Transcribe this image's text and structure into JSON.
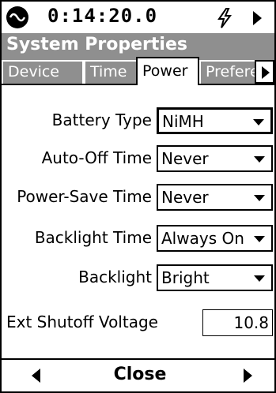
{
  "status": {
    "time": "0:14:20.0",
    "logo_icon": "meter-logo-icon",
    "power_icon": "lightning-bolt-icon",
    "run_icon": "play-triangle-icon"
  },
  "window": {
    "title": "System Properties"
  },
  "tabs": [
    {
      "label": "Device",
      "active": false
    },
    {
      "label": "Time",
      "active": false
    },
    {
      "label": "Power",
      "active": true
    },
    {
      "label": "Preferences",
      "active": false
    }
  ],
  "form": {
    "battery_type": {
      "label": "Battery Type",
      "value": "NiMH"
    },
    "auto_off_time": {
      "label": "Auto-Off Time",
      "value": "Never"
    },
    "power_save_time": {
      "label": "Power-Save Time",
      "value": "Never"
    },
    "backlight_time": {
      "label": "Backlight Time",
      "value": "Always On"
    },
    "backlight": {
      "label": "Backlight",
      "value": "Bright"
    },
    "ext_shutoff_voltage": {
      "label": "Ext Shutoff Voltage",
      "value": "10.8"
    }
  },
  "footer": {
    "close_label": "Close"
  },
  "colors": {
    "title_bg": "#8f8f8f",
    "title_fg": "#ffffff"
  }
}
